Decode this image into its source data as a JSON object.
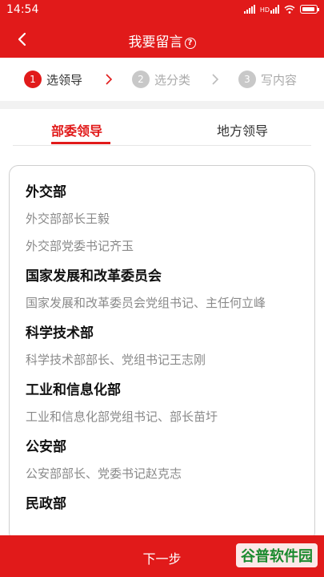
{
  "status_bar": {
    "time": "14:54",
    "network_badge": "HD"
  },
  "nav": {
    "title": "我要留言",
    "help_icon": "?"
  },
  "steps": [
    {
      "num": "1",
      "label": "选领导"
    },
    {
      "num": "2",
      "label": "选分类"
    },
    {
      "num": "3",
      "label": "写内容"
    }
  ],
  "tabs": [
    {
      "label": "部委领导"
    },
    {
      "label": "地方领导"
    }
  ],
  "departments": [
    {
      "name": "外交部",
      "leaders": [
        "外交部部长王毅",
        "外交部党委书记齐玉"
      ]
    },
    {
      "name": "国家发展和改革委员会",
      "leaders": [
        "国家发展和改革委员会党组书记、主任何立峰"
      ]
    },
    {
      "name": "科学技术部",
      "leaders": [
        "科学技术部部长、党组书记王志刚"
      ]
    },
    {
      "name": "工业和信息化部",
      "leaders": [
        "工业和信息化部党组书记、部长苗圩"
      ]
    },
    {
      "name": "公安部",
      "leaders": [
        "公安部部长、党委书记赵克志"
      ]
    },
    {
      "name": "民政部",
      "leaders": []
    }
  ],
  "footer": {
    "next_label": "下一步",
    "watermark": "谷普软件园"
  },
  "colors": {
    "primary": "#e11a1a",
    "inactive_step": "#c8c8c8"
  }
}
